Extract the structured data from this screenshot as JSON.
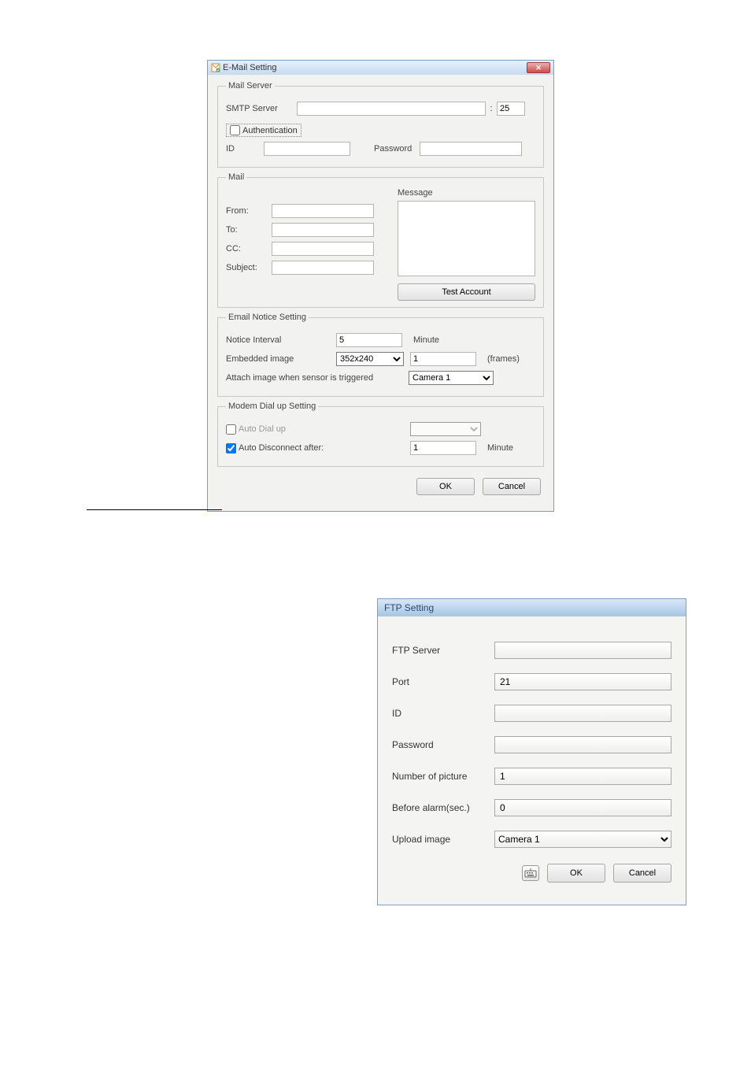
{
  "email": {
    "title": "E-Mail Setting",
    "mail_server": {
      "legend": "Mail Server",
      "smtp_label": "SMTP Server",
      "smtp_value": "",
      "port_sep": ":",
      "port_value": "25",
      "auth_label": "Authentication",
      "id_label": "ID",
      "id_value": "",
      "pwd_label": "Password",
      "pwd_value": ""
    },
    "mail": {
      "legend": "Mail",
      "message_label": "Message",
      "from_label": "From:",
      "from_value": "",
      "to_label": "To:",
      "to_value": "",
      "cc_label": "CC:",
      "cc_value": "",
      "subj_label": "Subject:",
      "subj_value": "",
      "msg_value": "",
      "test_btn": "Test Account"
    },
    "notice": {
      "legend": "Email Notice Setting",
      "interval_label": "Notice Interval",
      "interval_value": "5",
      "interval_unit": "Minute",
      "embedded_label": "Embedded image",
      "embedded_size": "352x240",
      "frames_value": "1",
      "frames_unit": "(frames)",
      "attach_label": "Attach image when sensor is triggered",
      "attach_cam": "Camera 1"
    },
    "modem": {
      "legend": "Modem Dial up Setting",
      "auto_dial_label": "Auto Dial up",
      "auto_dial_value": "",
      "disc_label": "Auto Disconnect after:",
      "disc_value": "1",
      "disc_unit": "Minute"
    },
    "buttons": {
      "ok": "OK",
      "cancel": "Cancel"
    }
  },
  "ftp": {
    "title": "FTP Setting",
    "server_label": "FTP Server",
    "server_value": "",
    "port_label": "Port",
    "port_value": "21",
    "id_label": "ID",
    "id_value": "",
    "pwd_label": "Password",
    "pwd_value": "",
    "npic_label": "Number of picture",
    "npic_value": "1",
    "before_label": "Before alarm(sec.)",
    "before_value": "0",
    "upload_label": "Upload image",
    "upload_cam": "Camera 1",
    "buttons": {
      "ok": "OK",
      "cancel": "Cancel"
    }
  }
}
